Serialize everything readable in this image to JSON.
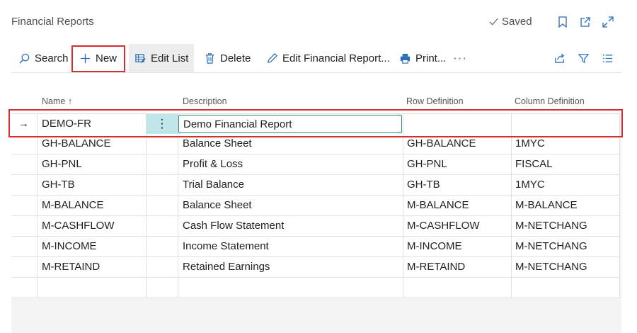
{
  "header": {
    "title": "Financial Reports",
    "saved_label": "Saved",
    "icons": [
      "bookmark-icon",
      "open-new-icon",
      "expand-icon"
    ]
  },
  "toolbar": {
    "search_label": "Search",
    "new_label": "New",
    "edit_list_label": "Edit List",
    "delete_label": "Delete",
    "edit_report_label": "Edit Financial Report...",
    "print_label": "Print...",
    "more_label": "···",
    "icons": [
      "share-icon",
      "filter-icon",
      "list-view-icon"
    ]
  },
  "grid": {
    "columns": [
      "Name ↑",
      "Description",
      "Row Definition",
      "Column Definition"
    ],
    "selected_row": {
      "arrow": "→",
      "name": "DEMO-FR",
      "menu": "⋮",
      "description": "Demo Financial Report",
      "row_definition": "",
      "column_definition": ""
    },
    "rows": [
      {
        "name": "GH-BALANCE",
        "description": "Balance Sheet",
        "row_definition": "GH-BALANCE",
        "column_definition": "1MYC"
      },
      {
        "name": "GH-PNL",
        "description": "Profit & Loss",
        "row_definition": "GH-PNL",
        "column_definition": "FISCAL"
      },
      {
        "name": "GH-TB",
        "description": "Trial Balance",
        "row_definition": "GH-TB",
        "column_definition": "1MYC"
      },
      {
        "name": "M-BALANCE",
        "description": "Balance Sheet",
        "row_definition": "M-BALANCE",
        "column_definition": "M-BALANCE"
      },
      {
        "name": "M-CASHFLOW",
        "description": "Cash Flow Statement",
        "row_definition": "M-CASHFLOW",
        "column_definition": "M-NETCHANG"
      },
      {
        "name": "M-INCOME",
        "description": "Income Statement",
        "row_definition": "M-INCOME",
        "column_definition": "M-NETCHANG"
      },
      {
        "name": "M-RETAIND",
        "description": "Retained Earnings",
        "row_definition": "M-RETAIND",
        "column_definition": "M-NETCHANG"
      }
    ]
  },
  "colors": {
    "highlight": "#d32f2f",
    "selected_cell": "#bfe7ea",
    "input_border": "#1f8a8f"
  }
}
